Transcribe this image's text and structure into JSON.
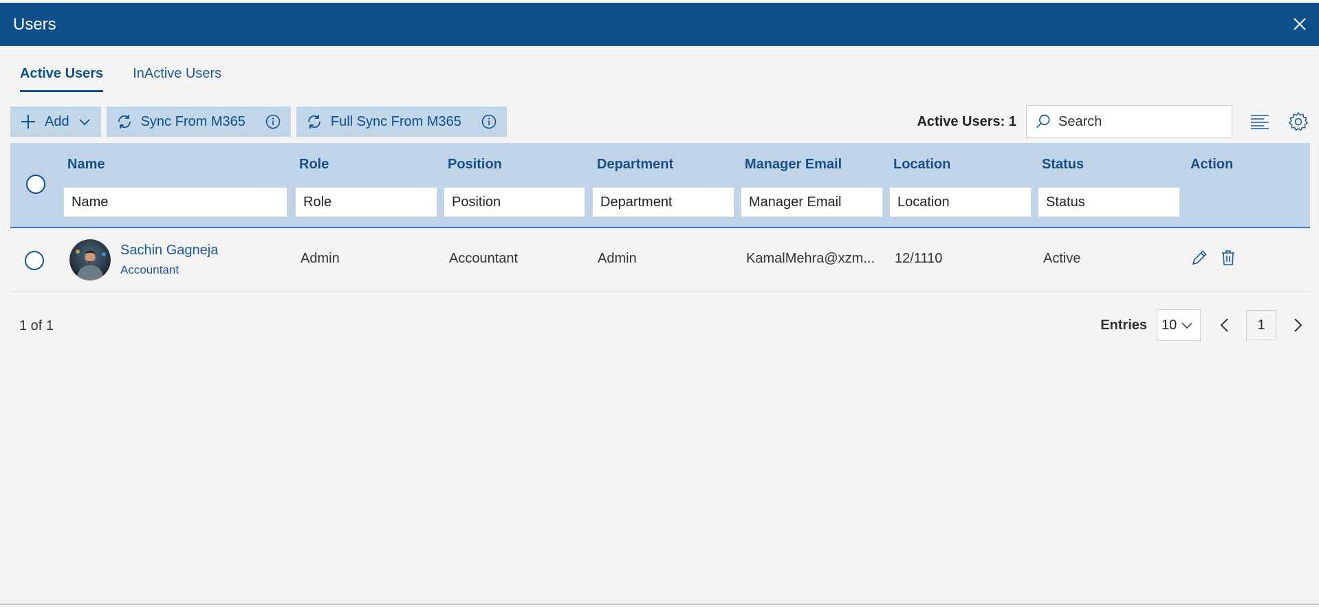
{
  "window": {
    "title": "Users"
  },
  "tabs": [
    {
      "label": "Active Users",
      "active": true
    },
    {
      "label": "InActive Users",
      "active": false
    }
  ],
  "toolbar": {
    "add_label": "Add",
    "sync_label": "Sync From M365",
    "full_sync_label": "Full Sync From M365"
  },
  "summary": {
    "count_label": "Active Users: 1"
  },
  "search": {
    "placeholder": "Search"
  },
  "columns": [
    {
      "label": "Name",
      "filter_placeholder": "Name"
    },
    {
      "label": "Role",
      "filter_placeholder": "Role"
    },
    {
      "label": "Position",
      "filter_placeholder": "Position"
    },
    {
      "label": "Department",
      "filter_placeholder": "Department"
    },
    {
      "label": "Manager Email",
      "filter_placeholder": "Manager Email"
    },
    {
      "label": "Location",
      "filter_placeholder": "Location"
    },
    {
      "label": "Status",
      "filter_placeholder": "Status"
    },
    {
      "label": "Action"
    }
  ],
  "rows": [
    {
      "name": "Sachin Gagneja",
      "subtitle": "Accountant",
      "role": "Admin",
      "position": "Accountant",
      "department": "Admin",
      "manager_email": "KamalMehra@xzm...",
      "location": "12/1110",
      "status": "Active"
    }
  ],
  "pagination": {
    "summary": "1 of 1",
    "entries_label": "Entries",
    "page_size": "10",
    "current_page": "1"
  },
  "colors": {
    "titlebar": "#0f4f8c",
    "header_bg": "#bfd4e8",
    "button_bg": "#c2d6ea",
    "accent": "#1a5a9a"
  }
}
